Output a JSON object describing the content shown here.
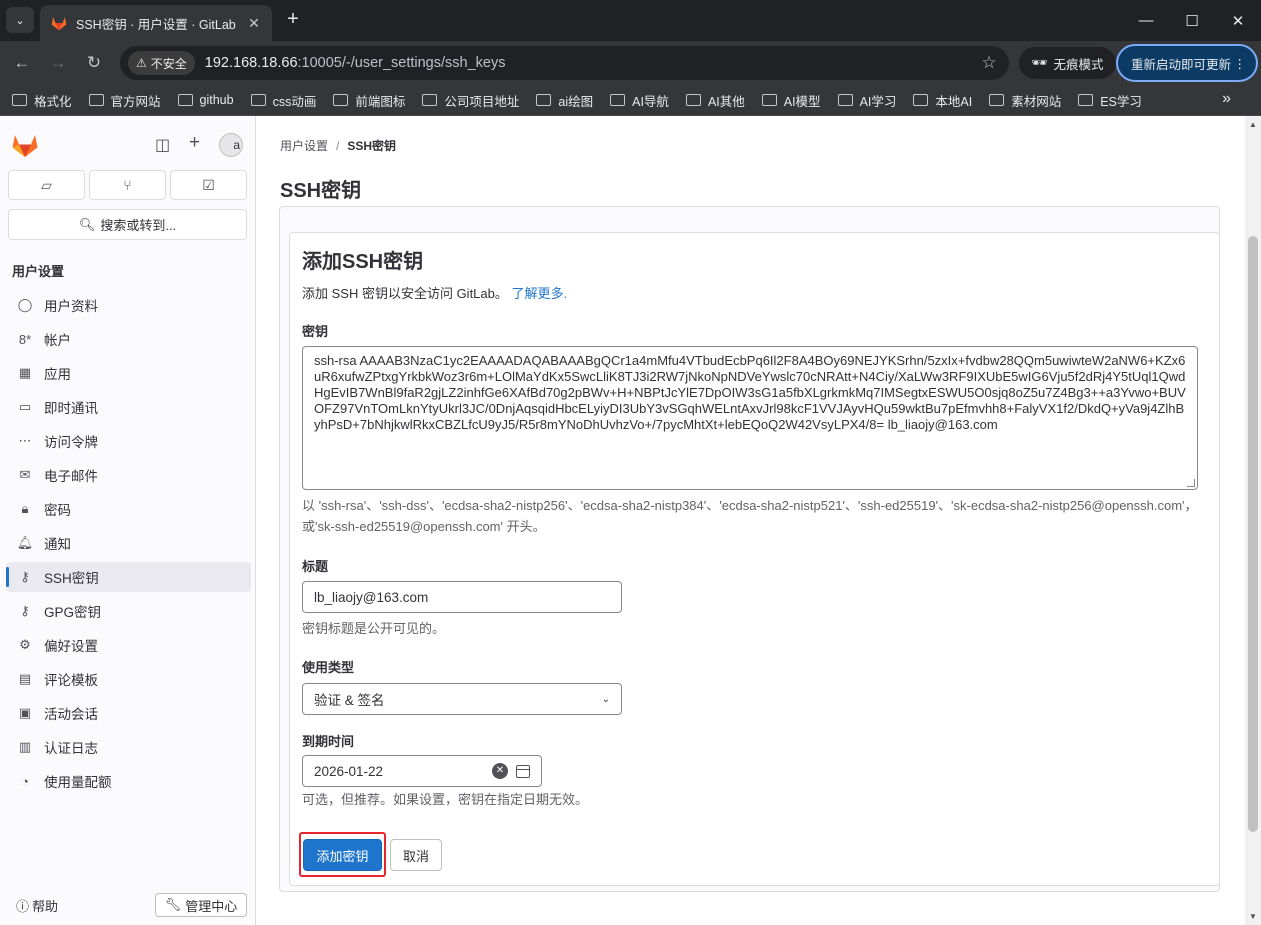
{
  "browser": {
    "tab_title": "SSH密钥 · 用户设置 · GitLab",
    "insecure_label": "不安全",
    "url_host": "192.168.18.66",
    "url_rest": ":10005/-/user_settings/ssh_keys",
    "incognito_label": "无痕模式",
    "update_label": "重新启动即可更新",
    "bookmarks": [
      "格式化",
      "官方网站",
      "github",
      "css动画",
      "前端图标",
      "公司项目地址",
      "ai绘图",
      "AI导航",
      "AI其他",
      "AI模型",
      "AI学习",
      "本地AI",
      "素材网站",
      "ES学习"
    ]
  },
  "sidebar": {
    "avatar_text": "a",
    "search_label": "搜索或转到...",
    "heading": "用户设置",
    "items": [
      {
        "label": "用户资料",
        "icon": "user-icon"
      },
      {
        "label": "帐户",
        "icon": "account-icon"
      },
      {
        "label": "应用",
        "icon": "applications-icon"
      },
      {
        "label": "即时通讯",
        "icon": "chat-icon"
      },
      {
        "label": "访问令牌",
        "icon": "token-icon"
      },
      {
        "label": "电子邮件",
        "icon": "mail-icon"
      },
      {
        "label": "密码",
        "icon": "lock-icon"
      },
      {
        "label": "通知",
        "icon": "bell-icon"
      },
      {
        "label": "SSH密钥",
        "icon": "key-icon"
      },
      {
        "label": "GPG密钥",
        "icon": "key-icon"
      },
      {
        "label": "偏好设置",
        "icon": "preferences-icon"
      },
      {
        "label": "评论模板",
        "icon": "comment-icon"
      },
      {
        "label": "活动会话",
        "icon": "monitor-icon"
      },
      {
        "label": "认证日志",
        "icon": "log-icon"
      },
      {
        "label": "使用量配额",
        "icon": "quota-icon"
      }
    ],
    "active_index": 8,
    "help_label": "帮助",
    "admin_label": "管理中心"
  },
  "main": {
    "breadcrumb": [
      "用户设置",
      "SSH密钥"
    ],
    "page_title": "SSH密钥",
    "form": {
      "title": "添加SSH密钥",
      "description": "添加 SSH 密钥以安全访问 GitLab。",
      "learn_more": "了解更多.",
      "key_label": "密钥",
      "key_value": "ssh-rsa AAAAB3NzaC1yc2EAAAADAQABAAABgQCr1a4mMfu4VTbudEcbPq6Il2F8A4BOy69NEJYKSrhn/5zxIx+fvdbw28QQm5uwiwteW2aNW6+KZx6uR6xufwZPtxgYrkbkWoz3r6m+LOlMaYdKx5SwcLliK8TJ3i2RW7jNkoNpNDVeYwslc70cNRAtt+N4Ciy/XaLWw3RF9IXUbE5wIG6Vju5f2dRj4Y5tUql1QwdHgEvIB7WnBl9faR2gjLZ2inhfGe6XAfBd70g2pBWv+H+NBPtJcYlE7DpOIW3sG1a5fbXLgrkmkMq7IMSegtxESWU5O0sjq8oZ5u7Z4Bg3++a3Yvwo+BUVOFZ97VnTOmLknYtyUkrl3JC/0DnjAqsqidHbcELyiyDI3UbY3vSGqhWELntAxvJrl98kcF1VVJAyvHQu59wktBu7pEfmvhh8+FalyVX1f2/DkdQ+yVa9j4ZlhByhPsD+7bNhjkwlRkxCBZLfcU9yJ5/R5r8mYNoDhUvhzVo+/7pycMhtXt+lebEQoQ2W42VsyLPX4/8= lb_liaojy@163.com",
      "key_hint": "以 'ssh-rsa'、'ssh-dss'、'ecdsa-sha2-nistp256'、'ecdsa-sha2-nistp384'、'ecdsa-sha2-nistp521'、'ssh-ed25519'、'sk-ecdsa-sha2-nistp256@openssh.com'，或'sk-ssh-ed25519@openssh.com' 开头。",
      "title_label": "标题",
      "title_value": "lb_liaojy@163.com",
      "title_hint": "密钥标题是公开可见的。",
      "usage_label": "使用类型",
      "usage_value": "验证 & 签名",
      "expiry_label": "到期时间",
      "expiry_value": "2026-01-22",
      "expiry_hint": "可选，但推荐。如果设置，密钥在指定日期无效。",
      "submit_label": "添加密钥",
      "cancel_label": "取消"
    }
  },
  "colors": {
    "primary": "#1f75cb",
    "highlight": "#e4262e",
    "gitlab_orange": "#fc6d26"
  }
}
